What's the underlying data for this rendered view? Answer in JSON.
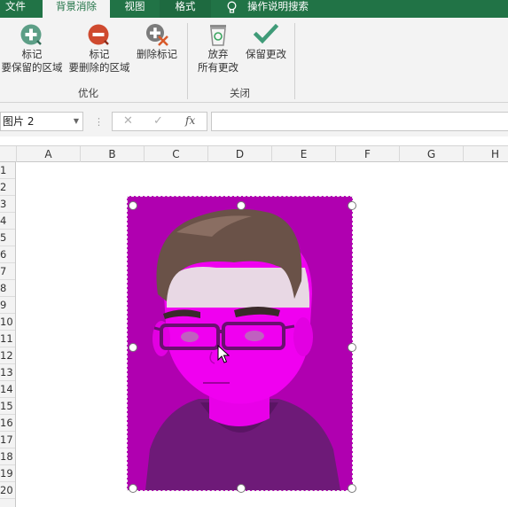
{
  "ribbon_tabs": {
    "file": "文件",
    "background_removal": "背景消除",
    "view": "视图",
    "format": "格式",
    "tell_me": "操作说明搜索"
  },
  "ribbon": {
    "mark_keep": {
      "line1": "标记",
      "line2": "要保留的区域",
      "icon": "plus-circle-icon"
    },
    "mark_remove": {
      "line1": "标记",
      "line2": "要删除的区域",
      "icon": "minus-circle-icon"
    },
    "delete_mark": {
      "label": "删除标记",
      "icon": "delete-mark-icon"
    },
    "discard_changes": {
      "line1": "放弃",
      "line2": "所有更改",
      "icon": "recycle-bin-icon"
    },
    "keep_changes": {
      "label": "保留更改",
      "icon": "check-icon"
    },
    "group_optimize": "优化",
    "group_close": "关闭"
  },
  "formula_bar": {
    "name_box": "图片 2",
    "cancel": "✕",
    "enter": "✓",
    "fx": "fx",
    "content": ""
  },
  "columns": [
    "A",
    "B",
    "C",
    "D",
    "E",
    "F",
    "G",
    "H"
  ],
  "rows": [
    "1",
    "2",
    "3",
    "4",
    "5",
    "6",
    "7",
    "8",
    "9",
    "10",
    "11",
    "12",
    "13",
    "14",
    "15",
    "16",
    "17",
    "18",
    "19",
    "20"
  ],
  "colors": {
    "excel_green": "#217346",
    "removal_overlay": "#b300b3",
    "keep_green": "#2e8b57",
    "remove_red": "#d0452a"
  }
}
